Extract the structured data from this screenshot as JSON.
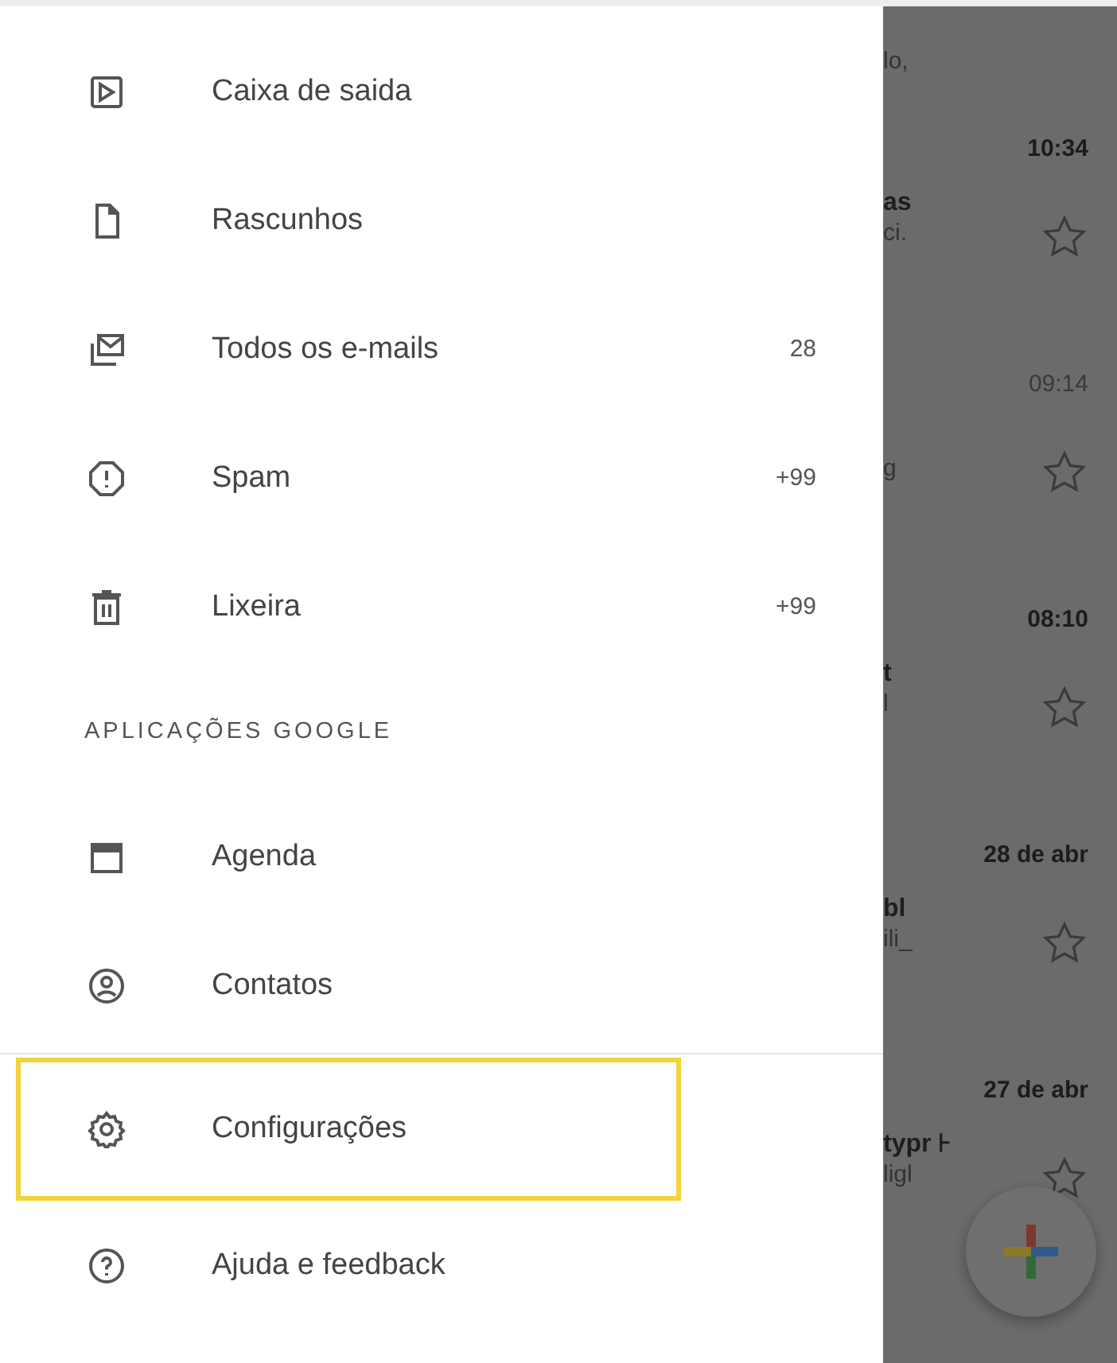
{
  "drawer": {
    "items": [
      {
        "kind": "item",
        "label": "Caixa de saida",
        "highlighted": false
      },
      {
        "kind": "item",
        "label": "Rascunhos",
        "highlighted": false
      },
      {
        "kind": "item",
        "label": "Todos os e-mails",
        "count": "28",
        "highlighted": false
      },
      {
        "kind": "item",
        "label": "Spam",
        "count": "+99",
        "highlighted": false
      },
      {
        "kind": "item",
        "label": "Lixeira",
        "count": "+99",
        "highlighted": false
      },
      {
        "kind": "header",
        "label": "APLICAÇÕES GOOGLE"
      },
      {
        "kind": "item",
        "label": "Agenda",
        "highlighted": false
      },
      {
        "kind": "item",
        "label": "Contatos",
        "highlighted": false
      },
      {
        "kind": "divider"
      },
      {
        "kind": "item",
        "label": "Configurações",
        "highlighted": true
      },
      {
        "kind": "item",
        "label": "Ajuda e feedback",
        "highlighted": false
      }
    ]
  },
  "inbox": {
    "emails": [
      {
        "snippet": "lo,"
      },
      {
        "time": "10:34",
        "unread": true,
        "sender": "as",
        "snippet": "ci."
      },
      {
        "time": "09:14",
        "unread": false,
        "snippet": "g"
      },
      {
        "time": "08:10",
        "unread": true,
        "sender": "t",
        "snippet": "l"
      },
      {
        "time": "28 de abr",
        "unread": true,
        "sender": "bl",
        "snippet": "ili_"
      },
      {
        "time": "27 de abr",
        "unread": true,
        "sender": "typr ⊦",
        "snippet": "ligl"
      }
    ]
  }
}
